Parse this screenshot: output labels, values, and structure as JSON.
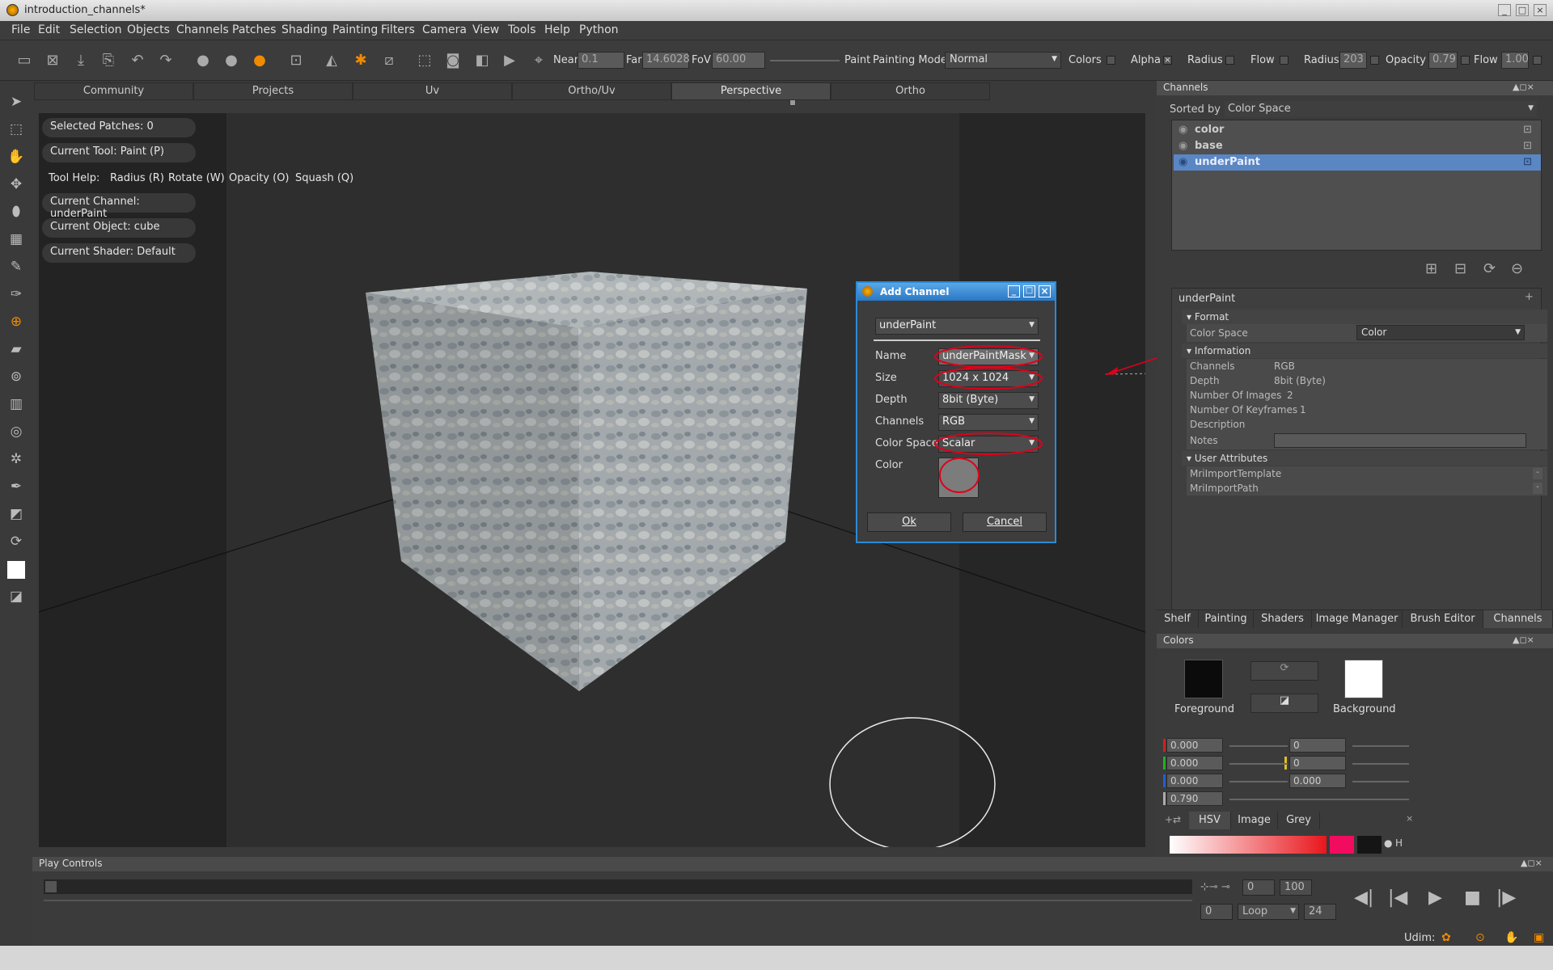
{
  "window": {
    "title": "introduction_channels*",
    "min": "_",
    "max": "□",
    "close": "×"
  },
  "menu": [
    "File",
    "Edit",
    "Selection",
    "Objects",
    "Channels",
    "Patches",
    "Shading",
    "Painting",
    "Filters",
    "Camera",
    "View",
    "Tools",
    "Help",
    "Python"
  ],
  "toolbar": {
    "near_label": "Near",
    "near_value": "0.1",
    "far_label": "Far",
    "far_value": "14.6028",
    "fov_label": "FoV",
    "fov_value": "60.00",
    "paint_label": "Paint",
    "painting_mode_label": "Painting Mode",
    "painting_mode_value": "Normal",
    "colors_label": "Colors",
    "alpha_label": "Alpha",
    "alpha_check": "×",
    "radius_label": "Radius",
    "flow_label": "Flow",
    "radius2_label": "Radius",
    "radius2_value": "203",
    "opacity_label": "Opacity",
    "opacity_value": "0.79",
    "flow2_label": "Flow",
    "flow2_value": "1.00"
  },
  "view_tabs": [
    "Community",
    "Projects",
    "Uv",
    "Ortho/Uv",
    "Perspective",
    "Ortho"
  ],
  "hud": {
    "selected_patches": "Selected Patches: 0",
    "current_tool": "Current Tool: Paint (P)",
    "tool_help": "Tool Help:",
    "help_radius": "Radius (R)",
    "help_rotate": "Rotate (W)",
    "help_opacity": "Opacity (O)",
    "help_squash": "Squash (Q)",
    "current_channel": "Current Channel: underPaint",
    "current_object": "Current Object: cube",
    "current_shader": "Current Shader: Default"
  },
  "dialog": {
    "title": "Add Channel",
    "preset": "underPaint",
    "name_label": "Name",
    "name_value": "underPaintMask",
    "size_label": "Size",
    "size_value": "1024 x 1024",
    "depth_label": "Depth",
    "depth_value": "8bit  (Byte)",
    "channels_label": "Channels",
    "channels_value": "RGB",
    "colorspace_label": "Color Space",
    "colorspace_value": "Scalar",
    "color_label": "Color",
    "ok": "Ok",
    "cancel": "Cancel",
    "highlight_color": "#e0001a"
  },
  "channels_panel": {
    "title": "Channels",
    "sorted_by_label": "Sorted by",
    "sorted_by_value": "Color Space",
    "items": [
      {
        "name": "color",
        "selected": false
      },
      {
        "name": "base",
        "selected": false
      },
      {
        "name": "underPaint",
        "selected": true
      }
    ]
  },
  "properties": {
    "object": "underPaint",
    "format_section": "Format",
    "color_space_label": "Color Space",
    "color_space_value": "Color",
    "information_section": "Information",
    "channels_label": "Channels",
    "channels_value": "RGB",
    "depth_label": "Depth",
    "depth_value": "8bit  (Byte)",
    "num_images_label": "Number Of Images",
    "num_images_value": "2",
    "num_keyframes_label": "Number Of Keyframes",
    "num_keyframes_value": "1",
    "description_label": "Description",
    "notes_label": "Notes",
    "user_attributes_section": "User Attributes",
    "attr1": "MriImportTemplate",
    "attr2": "MriImportPath"
  },
  "right_tabs": [
    "Shelf",
    "Painting",
    "Shaders",
    "Image Manager",
    "Brush Editor",
    "Channels"
  ],
  "colors_panel": {
    "title": "Colors",
    "foreground_label": "Foreground",
    "background_label": "Background",
    "rgb": [
      "0.000",
      "0.000",
      "0.000",
      "0.790"
    ],
    "hsv": [
      "0",
      "0",
      "0.000"
    ],
    "tabs": [
      "HSV",
      "Image",
      "Grey"
    ],
    "h_label": "H"
  },
  "play_controls": {
    "title": "Play Controls",
    "start": "0",
    "end": "100",
    "current": "0",
    "loop": "Loop",
    "fps": "24"
  },
  "status": {
    "udim_label": "Udim:"
  }
}
